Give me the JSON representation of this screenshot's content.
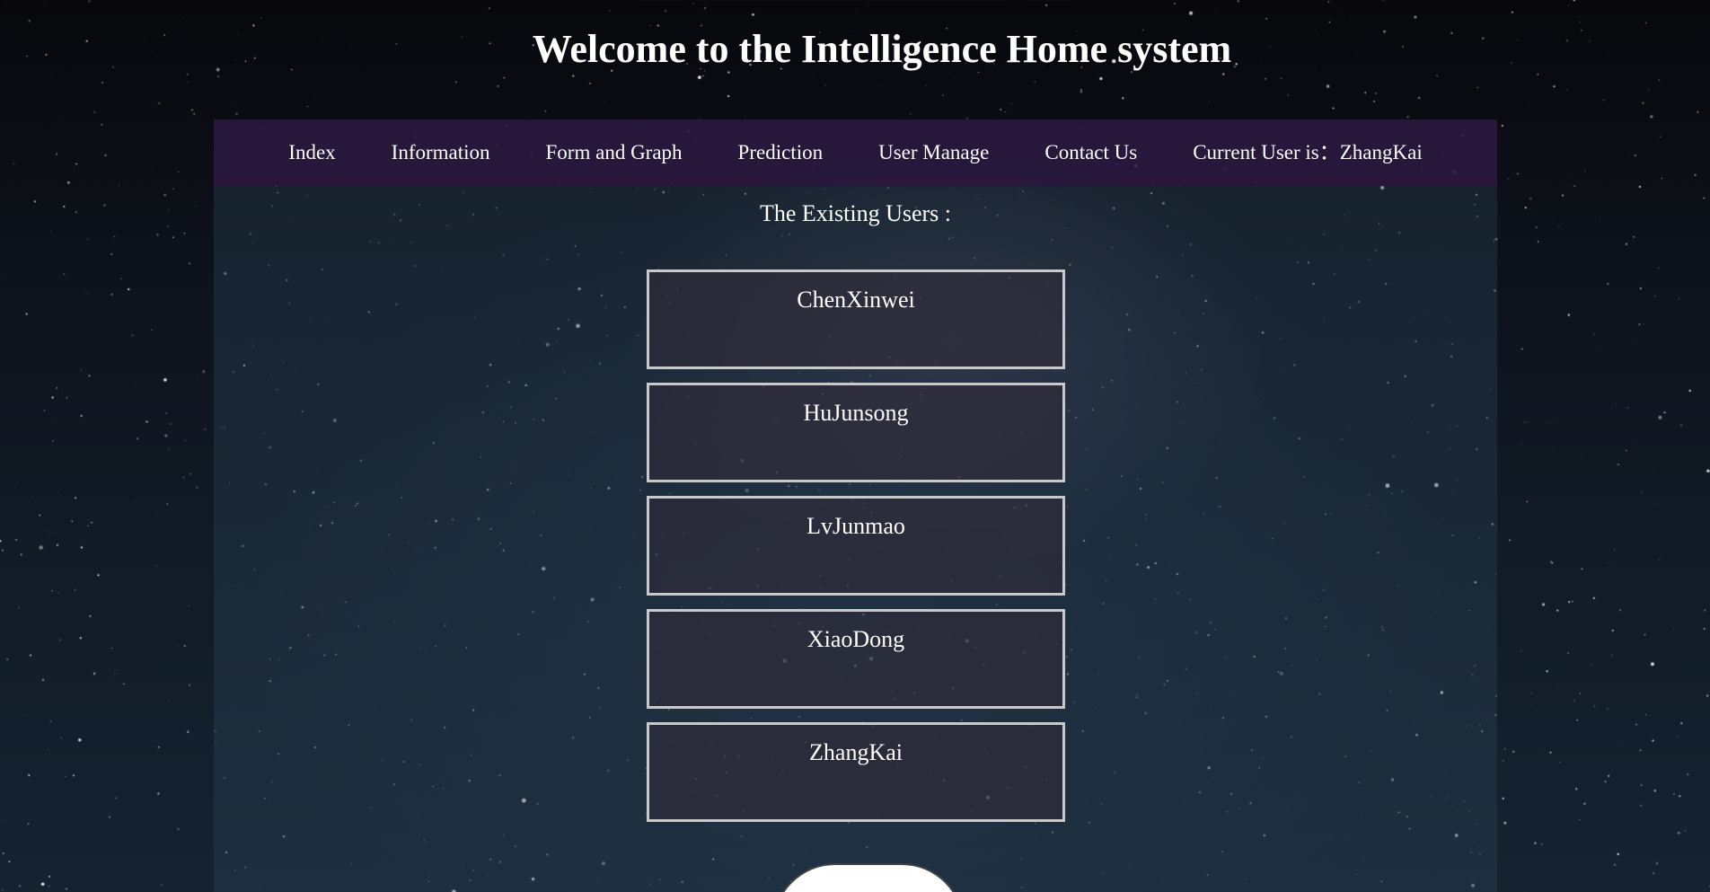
{
  "header": {
    "title": "Welcome to the Intelligence Home system"
  },
  "nav": {
    "items": [
      {
        "label": "Index"
      },
      {
        "label": "Information"
      },
      {
        "label": "Form and Graph"
      },
      {
        "label": "Prediction"
      },
      {
        "label": "User Manage"
      },
      {
        "label": "Contact Us"
      }
    ],
    "current_user_label": "Current User is：ZhangKai"
  },
  "main": {
    "heading": "The Existing Users :",
    "users": [
      {
        "name": "ChenXinwei"
      },
      {
        "name": "HuJunsong"
      },
      {
        "name": "LvJunmao"
      },
      {
        "name": "XiaoDong"
      },
      {
        "name": "ZhangKai"
      }
    ]
  },
  "colors": {
    "nav_background": "#2a163e",
    "card_border": "#c9c9cc",
    "text": "#ffffff"
  }
}
